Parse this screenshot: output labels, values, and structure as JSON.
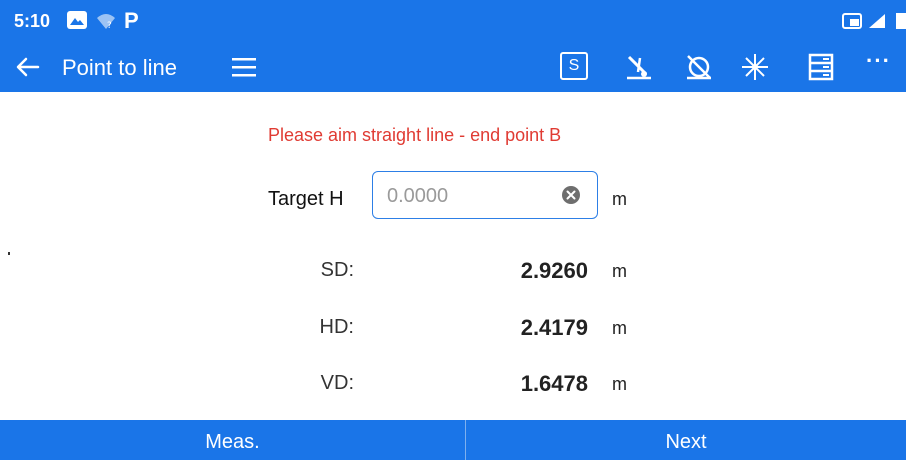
{
  "status_bar": {
    "time": "5:10",
    "left_icons": [
      "photo-icon",
      "wifi-icon",
      "parking-icon"
    ],
    "right_icons": [
      "cast-icon",
      "signal-icon",
      "battery-icon"
    ],
    "parking_glyph": "P"
  },
  "toolbar": {
    "back_icon": "arrow-left-icon",
    "title": "Point to line",
    "menu_icon": "hamburger-menu-icon",
    "s_label": "S",
    "tools": [
      "laser-pointer-icon",
      "compensator-off-icon",
      "laser-star-icon",
      "list-icon",
      "more-icon"
    ],
    "more_label": "···"
  },
  "main": {
    "prompt": "Please aim straight line - end point B",
    "target_h": {
      "label": "Target H",
      "value": "",
      "placeholder": "0.0000",
      "unit": "m"
    },
    "rows": [
      {
        "label": "SD:",
        "value": "2.9260",
        "unit": "m"
      },
      {
        "label": "HD:",
        "value": "2.4179",
        "unit": "m"
      },
      {
        "label": "VD:",
        "value": "1.6478",
        "unit": "m"
      }
    ]
  },
  "bottom": {
    "meas_label": "Meas.",
    "next_label": "Next"
  },
  "colors": {
    "primary": "#1a75e8",
    "prompt": "#e03b33",
    "input_border": "#2d7fe6"
  }
}
